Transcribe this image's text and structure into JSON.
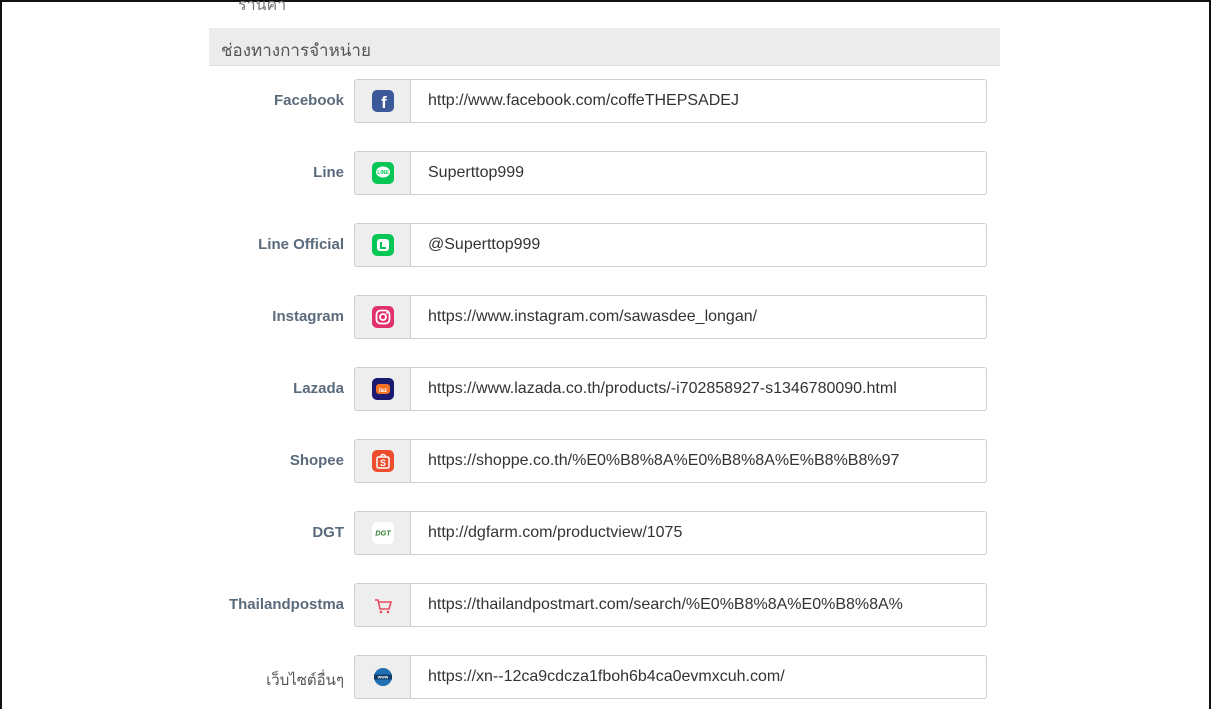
{
  "top_cut_text": "ร้านค้า",
  "section": {
    "title": "ช่องทางการจำหน่าย"
  },
  "rows": [
    {
      "label": "Facebook",
      "icon": "facebook-icon",
      "value": "http://www.facebook.com/coffeTHEPSADEJ"
    },
    {
      "label": "Line",
      "icon": "line-icon",
      "value": "Superttop999"
    },
    {
      "label": "Line Official",
      "icon": "line-official-icon",
      "value": "@Superttop999"
    },
    {
      "label": "Instagram",
      "icon": "instagram-icon",
      "value": "https://www.instagram.com/sawasdee_longan/"
    },
    {
      "label": "Lazada",
      "icon": "lazada-icon",
      "value": "https://www.lazada.co.th/products/-i702858927-s1346780090.html"
    },
    {
      "label": "Shopee",
      "icon": "shopee-icon",
      "value": "https://shoppe.co.th/%E0%B8%8A%E0%B8%8A%E%B8%B8%97"
    },
    {
      "label": "DGT",
      "icon": "dgt-icon",
      "value": "http://dgfarm.com/productview/1075"
    },
    {
      "label": "Thailandpostma",
      "icon": "thailandpostmart-cart-icon",
      "value": "https://thailandpostmart.com/search/%E0%B8%8A%E0%B8%8A%"
    },
    {
      "label": "เว็บไซต์อื่นๆ",
      "icon": "www-globe-icon",
      "value": "https://xn--12ca9cdcza1fboh6b4ca0evmxcuh.com/"
    }
  ],
  "colors": {
    "facebook": "#3b5998",
    "line": "#06c755",
    "instagram": "#e1306c",
    "lazada": "#1a1a6e",
    "shopee": "#ee4d2d",
    "thailandpostmart": "#e84a5f",
    "www": "#1f6fb2"
  }
}
